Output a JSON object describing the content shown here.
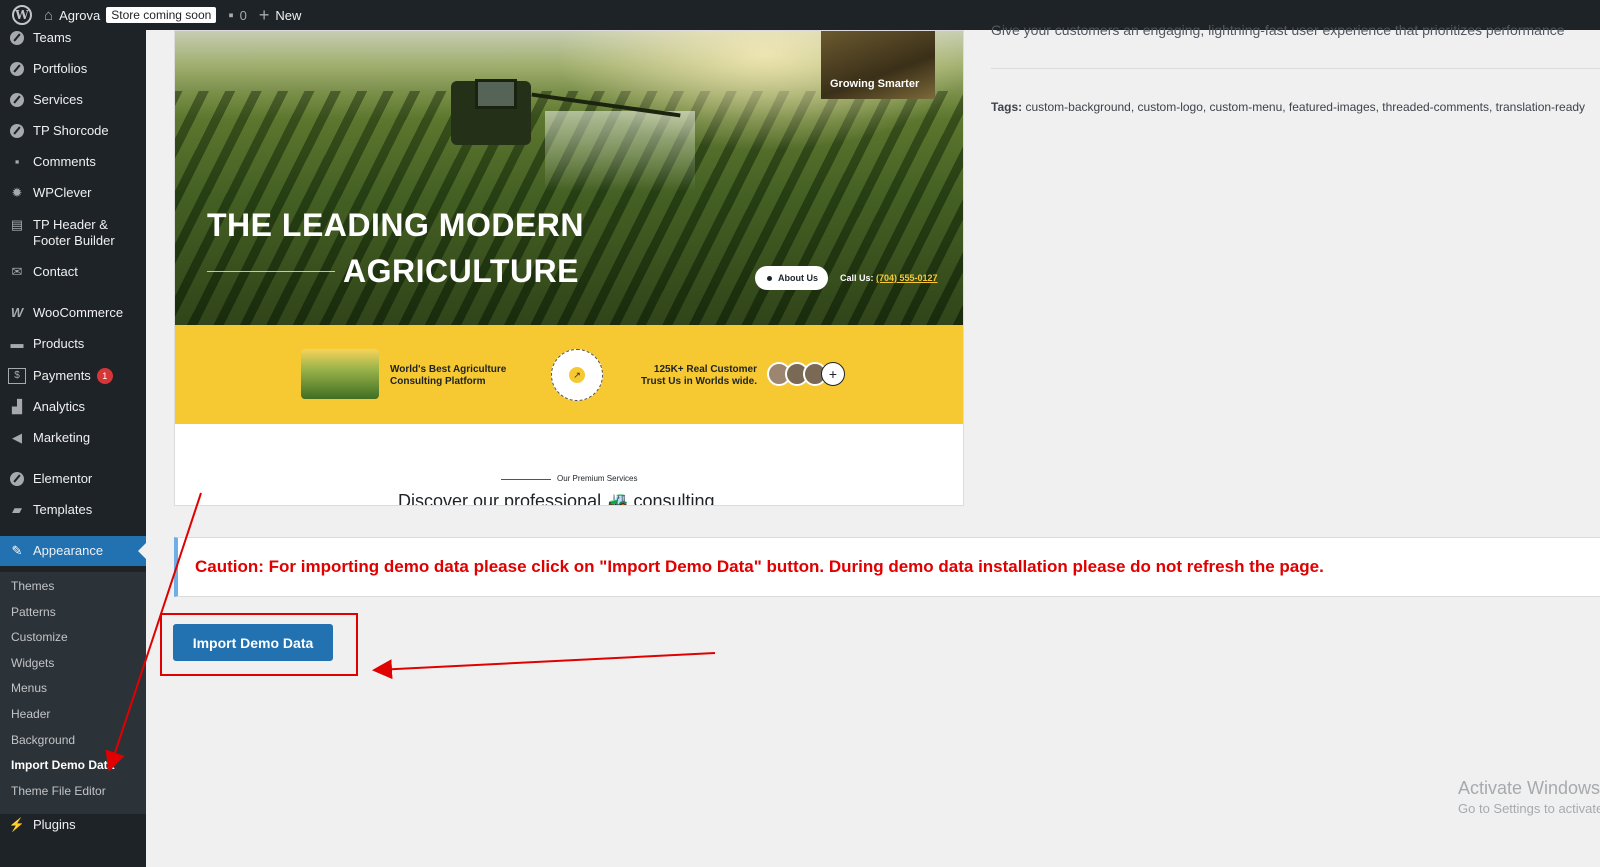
{
  "admin_bar": {
    "site_name": "Agrova",
    "store_badge": "Store coming soon",
    "comments_count": "0",
    "new_label": "New"
  },
  "sidebar": {
    "items": [
      {
        "label": "Teams",
        "icon": "circle-icon"
      },
      {
        "label": "Portfolios",
        "icon": "circle-icon"
      },
      {
        "label": "Services",
        "icon": "circle-icon"
      },
      {
        "label": "TP Shorcode",
        "icon": "circle-icon"
      },
      {
        "label": "Comments",
        "icon": "comment-icon"
      },
      {
        "label": "WPClever",
        "icon": "gear-icon"
      },
      {
        "label": "TP Header &\nFooter Builder",
        "icon": "layout-icon"
      },
      {
        "label": "Contact",
        "icon": "mail-icon"
      },
      {
        "label": "WooCommerce",
        "icon": "woo-icon"
      },
      {
        "label": "Products",
        "icon": "archive-icon"
      },
      {
        "label": "Payments",
        "icon": "dollar-icon",
        "badge": "1"
      },
      {
        "label": "Analytics",
        "icon": "bar-chart-icon"
      },
      {
        "label": "Marketing",
        "icon": "megaphone-icon"
      },
      {
        "label": "Elementor",
        "icon": "elementor-icon"
      },
      {
        "label": "Templates",
        "icon": "folder-icon"
      },
      {
        "label": "Appearance",
        "icon": "paintbrush-icon"
      },
      {
        "label": "Plugins",
        "icon": "plug-icon"
      }
    ],
    "submenu": [
      "Themes",
      "Patterns",
      "Customize",
      "Widgets",
      "Menus",
      "Header",
      "Background",
      "Import Demo Data",
      "Theme File Editor"
    ]
  },
  "preview": {
    "badge_text": "Growing Smarter",
    "title_line1": "THE LEADING MODERN",
    "title_line2": "AGRICULTURE",
    "about_button": "About Us",
    "call_label": "Call Us: ",
    "call_number": "(704) 555-0127",
    "band_text_1": "World's Best Agriculture\nConsulting Platform",
    "band_text_2": "125K+ Real Customer\nTrust Us in Worlds wide.",
    "services_small": "Our Premium Services",
    "services_heading": "Discover our professional 🚜 consulting"
  },
  "theme_info": {
    "description": "Give your customers an engaging, lightning-fast user experience that prioritizes performance",
    "tags_label": "Tags:",
    "tags": "custom-background, custom-logo, custom-menu, featured-images, threaded-comments, translation-ready"
  },
  "caution": "Caution: For importing demo data please click on \"Import Demo Data\" button. During demo data installation please do not refresh the page.",
  "import_button": "Import Demo Data",
  "watermark": {
    "title": "Activate Windows",
    "subtitle": "Go to Settings to activate Windows."
  },
  "colors": {
    "admin_dark": "#1d2327",
    "accent_blue": "#2271b1",
    "caution_red": "#e00000",
    "band_yellow": "#f6c832"
  }
}
